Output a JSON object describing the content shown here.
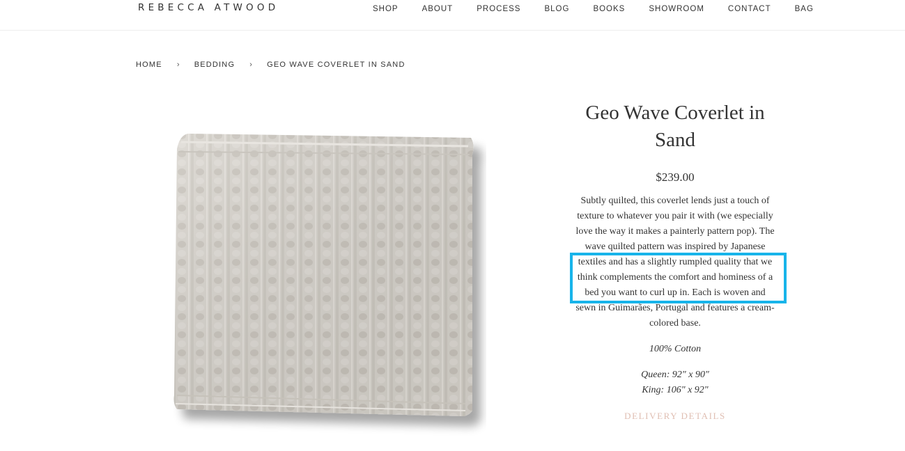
{
  "brand": {
    "logo_text": "REBECCA ATWOOD"
  },
  "nav": {
    "items": [
      {
        "label": "SHOP"
      },
      {
        "label": "ABOUT"
      },
      {
        "label": "PROCESS"
      },
      {
        "label": "BLOG"
      },
      {
        "label": "BOOKS"
      },
      {
        "label": "SHOWROOM"
      },
      {
        "label": "CONTACT"
      },
      {
        "label": "BAG"
      }
    ]
  },
  "breadcrumb": {
    "home": "HOME",
    "category": "BEDDING",
    "current": "GEO WAVE COVERLET IN SAND",
    "separator": "›"
  },
  "product": {
    "title_line1": "Geo Wave Coverlet in",
    "title_line2": "Sand",
    "price": "$239.00",
    "description_lines": [
      "Subtly quilted, this coverlet lends just a touch of",
      "texture to whatever you pair it with (we especially",
      "love the way it makes a painterly pattern pop). The",
      "wave quilted pattern was inspired by Japanese",
      "textiles and has a slightly rumpled quality that we",
      "think complements the comfort and hominess of a",
      "bed you want to curl up in. Each is woven and",
      "sewn in Guimarães, Portugal and features a cream-",
      "colored base."
    ],
    "material": "100% Cotton",
    "size_queen": "Queen: 92\" x 90\"",
    "size_king": "King: 106\" x 92\"",
    "delivery_link": "DELIVERY DETAILS"
  },
  "colors": {
    "text": "#333333",
    "delivery_link": "#e0bfb3",
    "highlight_box": "#18b4ea",
    "fabric": "#d6d2cb"
  }
}
